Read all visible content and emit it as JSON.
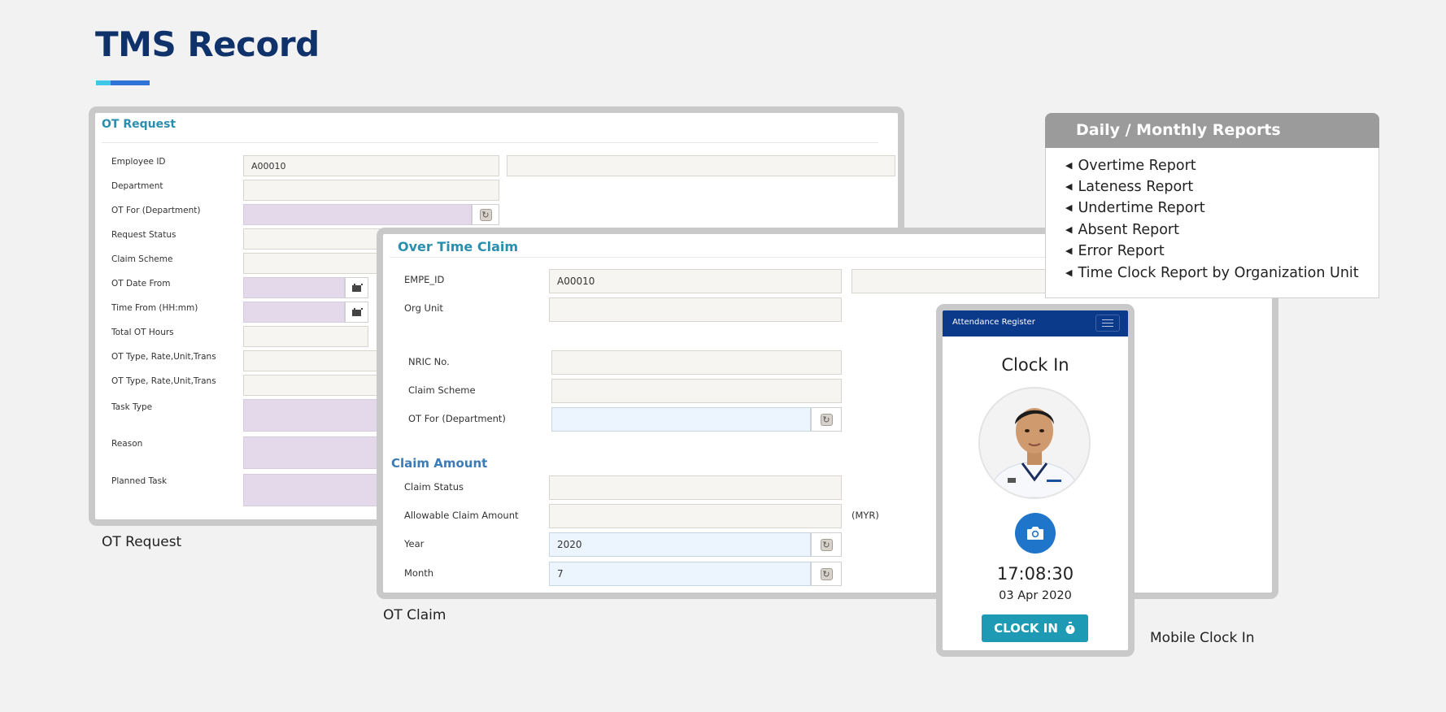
{
  "page": {
    "title": "TMS Record",
    "colors": {
      "title": "#10326b",
      "accent_light": "#3ec7e6",
      "accent": "#2f73d6"
    }
  },
  "ot_request": {
    "title": "OT Request",
    "caption": "OT Request",
    "fields": [
      {
        "label": "Employee ID",
        "value": "A00010"
      },
      {
        "label": "Department",
        "value": ""
      },
      {
        "label": "OT For (Department)",
        "value": ""
      },
      {
        "label": "Request Status",
        "value": ""
      },
      {
        "label": "Claim Scheme",
        "value": ""
      },
      {
        "label": "OT Date From",
        "value": ""
      },
      {
        "label": "Time From (HH:mm)",
        "value": ""
      },
      {
        "label": "Total OT Hours",
        "value": ""
      },
      {
        "label": "OT Type, Rate,Unit,Trans",
        "value": ""
      },
      {
        "label": "OT Type, Rate,Unit,Trans",
        "value": ""
      },
      {
        "label": "Task Type",
        "value": ""
      },
      {
        "label": "Reason",
        "value": ""
      },
      {
        "label": "Planned Task",
        "value": ""
      }
    ]
  },
  "ot_claim": {
    "title": "Over Time Claim",
    "caption": "OT Claim",
    "fields": [
      {
        "label": "EMPE_ID",
        "value": "A00010"
      },
      {
        "label": "Org Unit",
        "value": ""
      },
      {
        "label": "NRIC No.",
        "value": ""
      },
      {
        "label": "Claim Scheme",
        "value": ""
      },
      {
        "label": "OT For (Department)",
        "value": ""
      }
    ],
    "claim_amount": {
      "title": "Claim Amount",
      "fields": [
        {
          "label": "Claim Status",
          "value": ""
        },
        {
          "label": "Allowable Claim Amount",
          "value": "",
          "unit": "(MYR)"
        },
        {
          "label": "Year",
          "value": "2020"
        },
        {
          "label": "Month",
          "value": "7"
        }
      ]
    }
  },
  "reports": {
    "title": "Daily / Monthly Reports",
    "items": [
      "Overtime Report",
      "Lateness Report",
      "Undertime Report",
      "Absent Report",
      "Error Report",
      "Time Clock Report by Organization Unit"
    ]
  },
  "mobile": {
    "header_title": "Attendance Register",
    "heading": "Clock In",
    "time": "17:08:30",
    "date": "03 Apr 2020",
    "button_label": "CLOCK IN",
    "caption": "Mobile Clock In",
    "icons": {
      "menu": "hamburger-icon",
      "camera": "camera-icon",
      "button": "stopwatch-icon"
    }
  }
}
